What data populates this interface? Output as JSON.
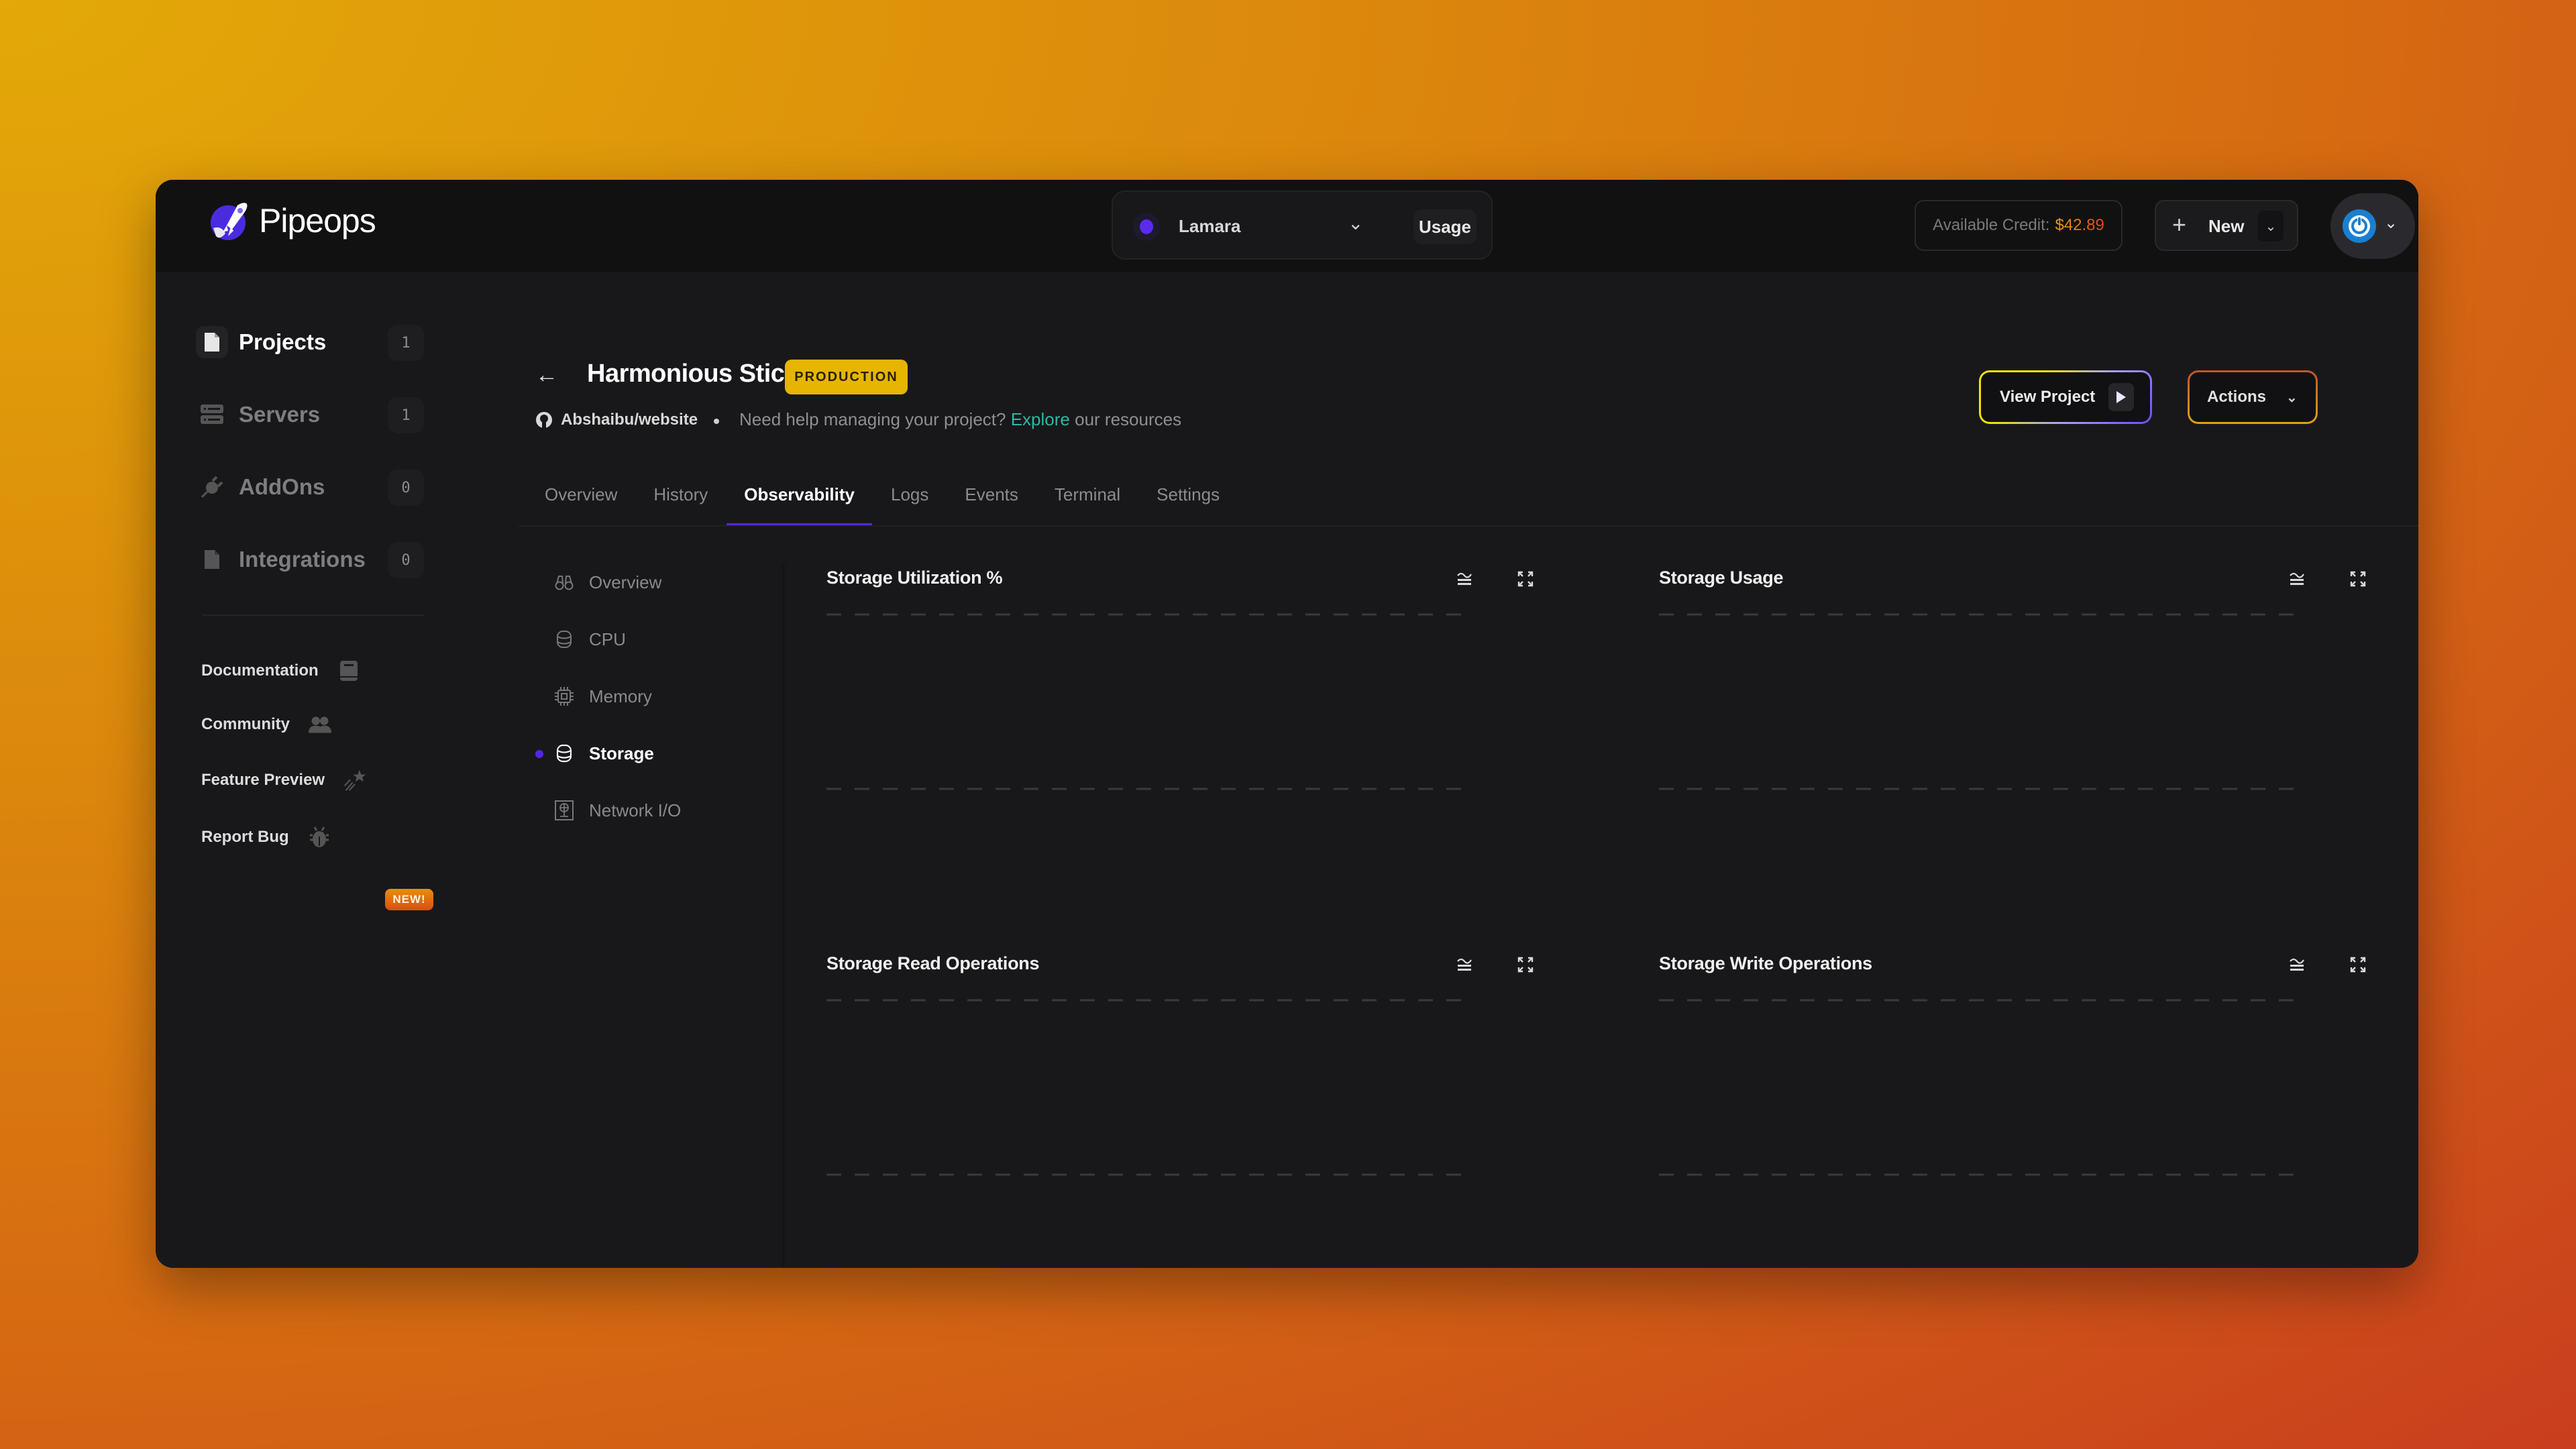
{
  "app": {
    "name": "Pipeops"
  },
  "header": {
    "environment": {
      "name": "Lamara",
      "status_color": "#5b2af0"
    },
    "usage_label": "Usage",
    "credit": {
      "label": "Available Credit:",
      "amount": "$42.89"
    },
    "new_label": "New",
    "avatar_icon": "power-icon"
  },
  "sidebar": {
    "items": [
      {
        "label": "Projects",
        "count": "1",
        "icon": "file-icon",
        "active": true
      },
      {
        "label": "Servers",
        "count": "1",
        "icon": "server-icon",
        "active": false
      },
      {
        "label": "AddOns",
        "count": "0",
        "icon": "plug-icon",
        "active": false
      },
      {
        "label": "Integrations",
        "count": "0",
        "icon": "file-icon",
        "active": false
      }
    ],
    "links": [
      {
        "label": "Documentation",
        "icon": "book-icon"
      },
      {
        "label": "Community",
        "icon": "users-icon",
        "badge": "NEW!"
      },
      {
        "label": "Feature Preview",
        "icon": "shooting-star-icon"
      },
      {
        "label": "Report Bug",
        "icon": "bug-icon"
      }
    ]
  },
  "project": {
    "title": "Harmonious Stick",
    "badge": "PRODUCTION",
    "repo": "Abshaibu/website",
    "help_prefix": "Need help managing your project?",
    "help_link": "Explore",
    "help_suffix": "our resources",
    "view_project_label": "View Project",
    "actions_label": "Actions"
  },
  "tabs": [
    {
      "label": "Overview",
      "active": false
    },
    {
      "label": "History",
      "active": false
    },
    {
      "label": "Observability",
      "active": true
    },
    {
      "label": "Logs",
      "active": false
    },
    {
      "label": "Events",
      "active": false
    },
    {
      "label": "Terminal",
      "active": false
    },
    {
      "label": "Settings",
      "active": false
    }
  ],
  "subnav": [
    {
      "label": "Overview",
      "icon": "binoculars-icon",
      "active": false
    },
    {
      "label": "CPU",
      "icon": "database-icon",
      "active": false
    },
    {
      "label": "Memory",
      "icon": "chip-icon",
      "active": false
    },
    {
      "label": "Storage",
      "icon": "database-icon",
      "active": true
    },
    {
      "label": "Network I/O",
      "icon": "network-icon",
      "active": false
    }
  ],
  "chart_data": [
    {
      "type": "line",
      "title": "Storage Utilization %",
      "series": [],
      "grid": true,
      "gridlines": 2
    },
    {
      "type": "line",
      "title": "Storage Usage",
      "series": [],
      "grid": true,
      "gridlines": 2
    },
    {
      "type": "line",
      "title": "Storage Read Operations",
      "series": [],
      "grid": true,
      "gridlines": 2
    },
    {
      "type": "line",
      "title": "Storage Write Operations",
      "series": [],
      "grid": true,
      "gridlines": 2
    }
  ]
}
